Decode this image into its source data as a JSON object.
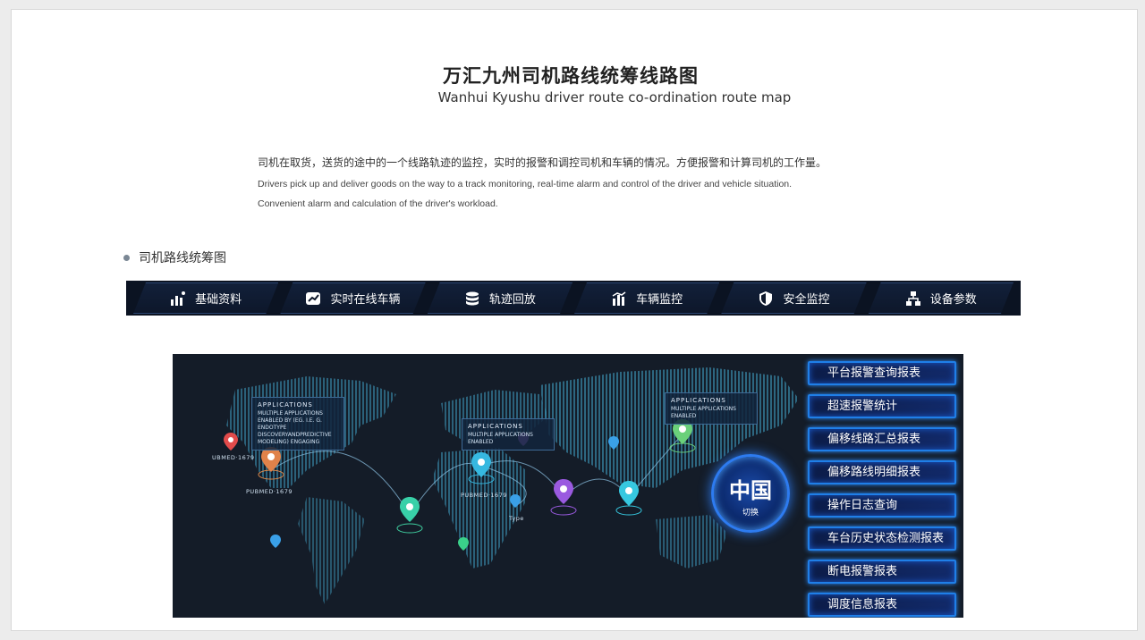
{
  "header": {
    "title_cn": "万汇九州司机路线统筹线路图",
    "title_en": "Wanhui Kyushu driver route co-ordination route map"
  },
  "description": {
    "cn": "司机在取货，送货的途中的一个线路轨迹的监控，实时的报警和调控司机和车辆的情况。方便报警和计算司机的工作量。",
    "en_line1": "Drivers pick up and deliver goods on the way to a track monitoring, real-time alarm and control of the driver and vehicle situation.",
    "en_line2": "Convenient alarm and calculation of the driver's workload."
  },
  "section": {
    "title": "司机路线统筹图"
  },
  "nav": {
    "items": [
      {
        "label": "基础资料",
        "icon": "bar-chart-people-icon"
      },
      {
        "label": "实时在线车辆",
        "icon": "trend-line-icon"
      },
      {
        "label": "轨迹回放",
        "icon": "database-icon"
      },
      {
        "label": "车辆监控",
        "icon": "bar-chart-icon"
      },
      {
        "label": "安全监控",
        "icon": "shield-icon"
      },
      {
        "label": "设备参数",
        "icon": "network-icon"
      }
    ]
  },
  "map": {
    "china_button": {
      "label": "中国",
      "sub": "切换"
    },
    "cards": [
      {
        "title": "APPLICATIONS",
        "body": "MULTIPLE APPLICATIONS ENABLED BY (EG. I.E. G. ENDOTYPE DISCOVERYANDPREDICTIVE MODELING) ENGAGING"
      },
      {
        "title": "APPLICATIONS",
        "body": "MULTIPLE APPLICATIONS ENABLED"
      },
      {
        "title": "APPLICATIONS",
        "body": "MULTIPLE APPLICATIONS ENABLED"
      }
    ],
    "labels": [
      "UBMED·1679",
      "PUBMED·1679",
      "PUBMED·1679",
      "Type"
    ],
    "reports": [
      "平台报警查询报表",
      "超速报警统计",
      "偏移线路汇总报表",
      "偏移路线明细报表",
      "操作日志查询",
      "车台历史状态检测报表",
      "断电报警报表",
      "调度信息报表"
    ],
    "colors": {
      "accent": "#1f7fe8",
      "map_bg": "#141c28",
      "land": "#3a7fa0"
    }
  }
}
